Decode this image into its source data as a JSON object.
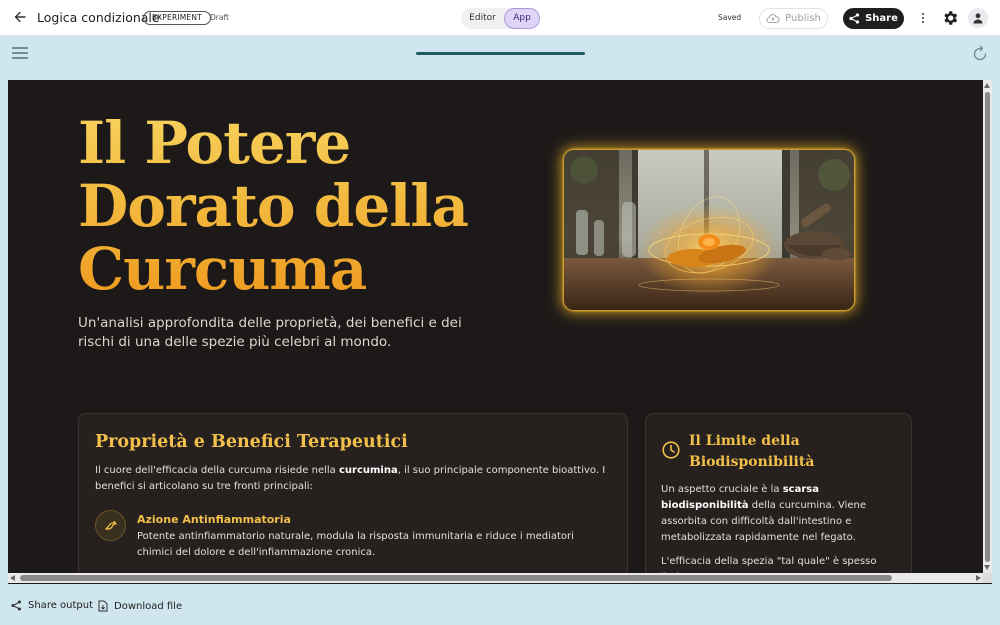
{
  "header": {
    "title": "Logica condizionale",
    "badge": "EXPERIMENT",
    "status": "Draft",
    "mode_tabs": [
      {
        "label": "Editor",
        "active": false
      },
      {
        "label": "App",
        "active": true
      }
    ],
    "saved_label": "Saved",
    "publish_label": "Publish",
    "share_label": "Share"
  },
  "app_content": {
    "hero": {
      "title_lines": [
        "Il Potere",
        "Dorato della",
        "Curcuma"
      ],
      "subtitle": "Un'analisi approfondita delle proprietà, dei benefici e dei rischi di una delle spezie più celebri al mondo."
    },
    "benefits_card": {
      "title": "Proprietà e Benefici Terapeutici",
      "intro_pre": "Il cuore dell'efficacia della curcuma risiede nella ",
      "intro_bold": "curcumina",
      "intro_post": ", il suo principale componente bioattivo. I benefici si articolano su tre fronti principali:",
      "feature_title": "Azione Antinfiammatoria",
      "feature_desc": "Potente antinfiammatorio naturale, modula la risposta immunitaria e riduce i mediatori chimici del dolore e dell'infiammazione cronica."
    },
    "limit_card": {
      "title": "Il Limite della Biodisponibilità",
      "p1_pre": "Un aspetto cruciale è la ",
      "p1_bold": "scarsa biodisponibilità",
      "p1_post": " della curcumina. Viene assorbita con difficoltà dall'intestino e metabolizzata rapidamente nel fegato.",
      "p2": "L'efficacia della spezia \"tal quale\" è spesso limitata."
    }
  },
  "footer": {
    "share_output_label": "Share output",
    "download_label": "Download file"
  },
  "colors": {
    "accent_gold": "#f2c04a",
    "dark_bg": "#1c1918",
    "shell_bg": "#cfe6ee",
    "progress": "#1e5d5f"
  }
}
